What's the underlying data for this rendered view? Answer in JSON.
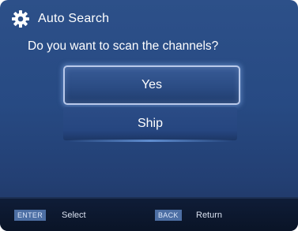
{
  "header": {
    "icon": "gear-icon",
    "title": "Auto Search"
  },
  "prompt": "Do you want to scan the channels?",
  "options": [
    {
      "label": "Yes",
      "selected": true
    },
    {
      "label": "Ship",
      "selected": false
    }
  ],
  "footer": {
    "hints": [
      {
        "key": "ENTER",
        "action": "Select"
      },
      {
        "key": "BACK",
        "action": "Return"
      }
    ]
  },
  "colors": {
    "background": "#274a83",
    "footer": "#0f1d38",
    "highlight_border": "#b9c9ea",
    "key_badge": "#4d6fa4"
  }
}
